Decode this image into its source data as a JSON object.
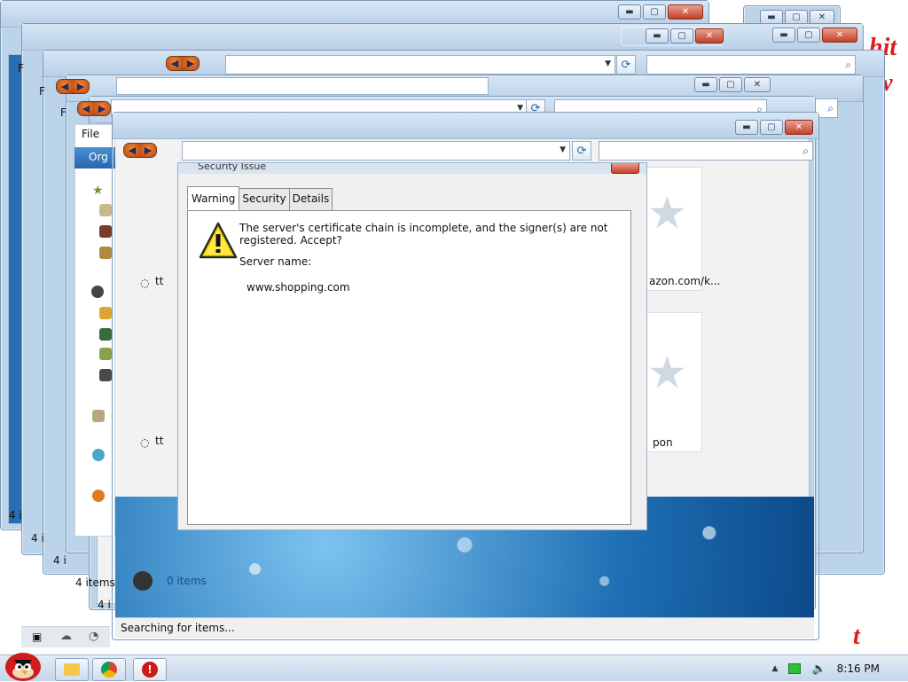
{
  "desktop": {
    "fragment_text_1": "hit",
    "fragment_text_2": "w",
    "fragment_text_3": "t"
  },
  "browser": {
    "file_menu": "File",
    "organize_label": "Org",
    "status_text": "Searching for items...",
    "items_count_a": "4 items",
    "items_count_b": "0 items",
    "items_frag_1": "4 i",
    "items_frag_2": "4 i",
    "items_frag_3": "4 i",
    "items_frag_4": "4 i",
    "url_frag_1": "azon.com/",
    "url_frag_1b": "k...",
    "url_frag_2": "pon",
    "url_frag_3": "tt",
    "url_frag_4": "tt",
    "f_frag": "F"
  },
  "dialog": {
    "title": "Security Issue",
    "tabs": [
      "Warning",
      "Security",
      "Details"
    ],
    "message": "The server's certificate chain is incomplete, and the signer(s) are not registered. Accept?",
    "server_label": "Server name:",
    "server_name": "www.shopping.com"
  },
  "taskbar": {
    "time": "8:16 PM"
  },
  "colors": {
    "accent_blue": "#2866ad",
    "warning_yellow": "#f4d400",
    "close_red": "#c3402a"
  }
}
